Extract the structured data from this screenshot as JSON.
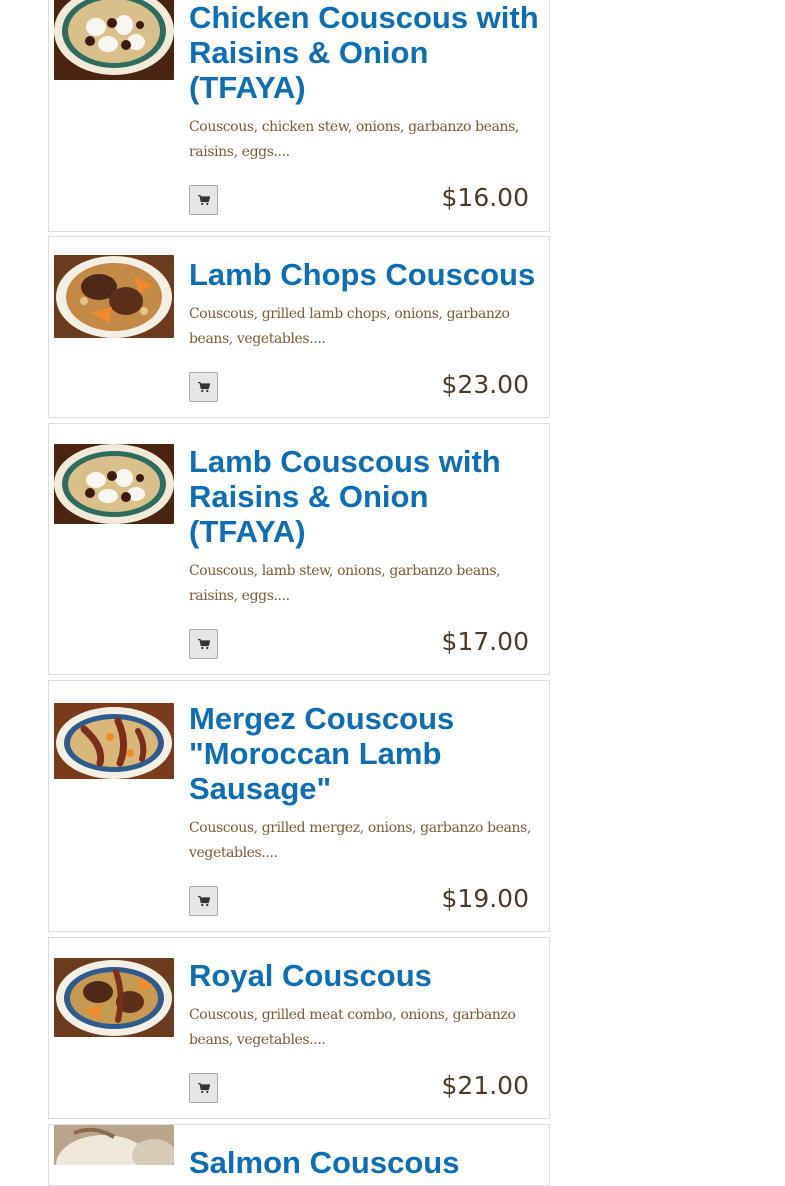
{
  "menu": {
    "items": [
      {
        "title": "Chicken Couscous with Raisins & Onion (TFAYA)",
        "description": "Couscous, chicken stew, onions, garbanzo beans, raisins, eggs....",
        "price": "$16.00",
        "image": "tfaya-couscous-photo"
      },
      {
        "title": "Lamb Chops Couscous",
        "description": "Couscous, grilled lamb chops, onions, garbanzo beans, vegetables....",
        "price": "$23.00",
        "image": "lamb-chops-couscous-photo"
      },
      {
        "title": "Lamb Couscous with Raisins & Onion (TFAYA)",
        "description": "Couscous, lamb stew, onions, garbanzo beans, raisins, eggs....",
        "price": "$17.00",
        "image": "tfaya-couscous-photo"
      },
      {
        "title": "Mergez Couscous \"Moroccan Lamb Sausage\"",
        "description": "Couscous, grilled mergez, onions, garbanzo beans, vegetables....",
        "price": "$19.00",
        "image": "mergez-couscous-photo"
      },
      {
        "title": "Royal Couscous",
        "description": "Couscous, grilled meat combo, onions, garbanzo beans, vegetables....",
        "price": "$21.00",
        "image": "royal-couscous-photo"
      },
      {
        "title": "Salmon Couscous",
        "description": "",
        "price": "",
        "image": "partial-dish-photo"
      }
    ],
    "cart_icon": "shopping-cart-icon"
  },
  "colors": {
    "title": "#0e6eb5",
    "description": "#7a5c37",
    "price": "#4a3b2a",
    "card_border": "#dcdcdc",
    "button_bg": "#e6e6e6"
  }
}
